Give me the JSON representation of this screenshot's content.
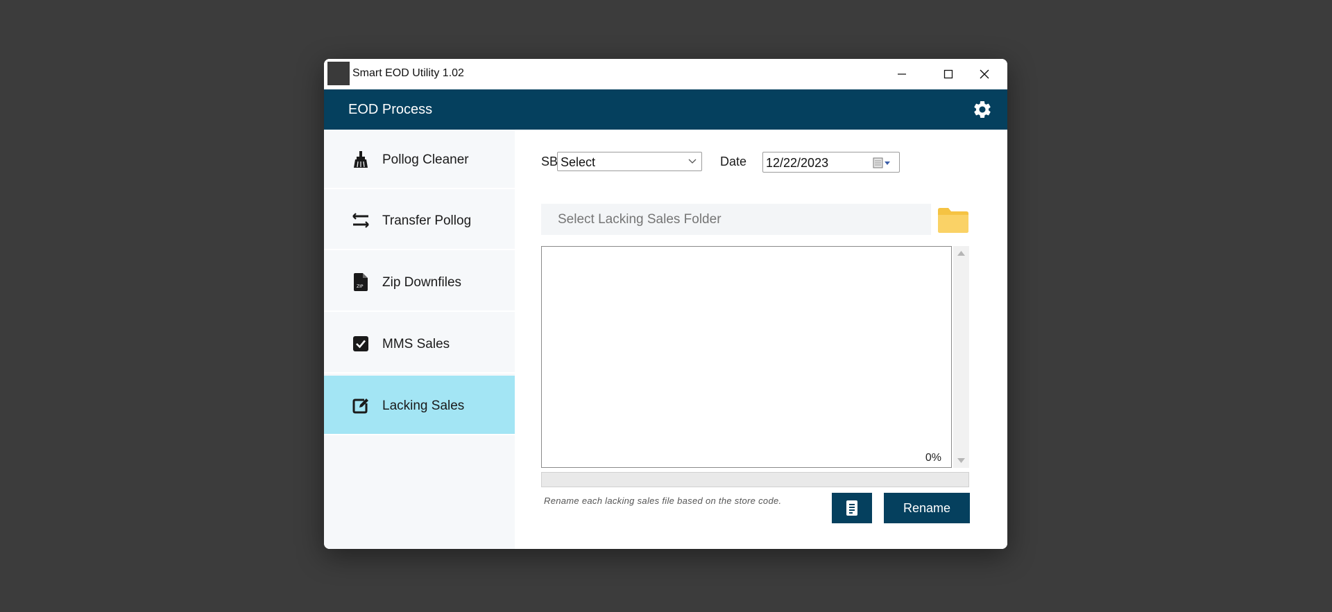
{
  "window": {
    "title": "Smart EOD Utility 1.02"
  },
  "header": {
    "title": "EOD Process",
    "settings_icon": "gear-icon"
  },
  "sidebar": {
    "items": [
      {
        "label": "Pollog Cleaner",
        "icon": "broom-icon",
        "active": false
      },
      {
        "label": "Transfer Pollog",
        "icon": "transfer-arrows-icon",
        "active": false
      },
      {
        "label": "Zip Downfiles",
        "icon": "zip-file-icon",
        "active": false
      },
      {
        "label": "MMS Sales",
        "icon": "checkbox-icon",
        "active": false
      },
      {
        "label": "Lacking Sales",
        "icon": "edit-icon",
        "active": true
      }
    ]
  },
  "form": {
    "sbu_label": "SBU",
    "sbu_value": "Select",
    "date_label": "Date",
    "date_value": "12/22/2023",
    "folder_placeholder": "Select Lacking Sales Folder",
    "output_percent": "0%",
    "progress": 0,
    "hint": "Rename each lacking sales file based on the store code.",
    "rename_label": "Rename"
  },
  "colors": {
    "header_bg": "#05405e",
    "active_item_bg": "#a3e5f4",
    "button_bg": "#05405e",
    "folder_icon": "#f7c849"
  }
}
